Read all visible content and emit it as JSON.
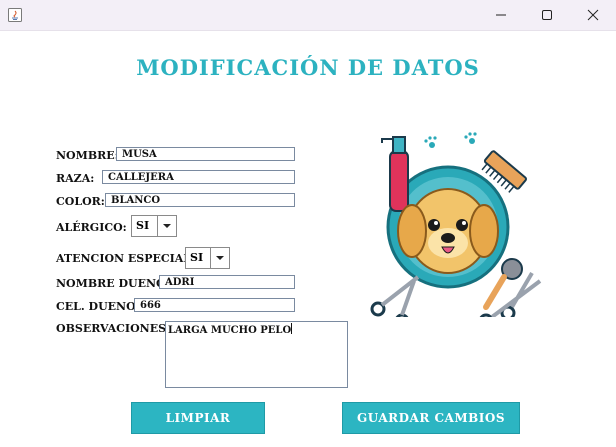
{
  "window": {
    "title": "",
    "minimize_icon": "minimize-icon",
    "maximize_icon": "maximize-icon",
    "close_icon": "close-icon"
  },
  "form": {
    "title": "MODIFICACIÓN DE DATOS",
    "fields": {
      "nombre": {
        "label": "NOMBRE:",
        "value": "MUSA"
      },
      "raza": {
        "label": "RAZA:",
        "value": "CALLEJERA"
      },
      "color": {
        "label": "COLOR:",
        "value": "BLANCO"
      },
      "alergico": {
        "label": "ALÉRGICO:",
        "value": "SI"
      },
      "atencion": {
        "label": "ATENCION ESPECIAL:",
        "value": "SI"
      },
      "dueno": {
        "label": "NOMBRE DUENO:",
        "value": "ADRI"
      },
      "celular": {
        "label": "CEL. DUENO:",
        "value": "666"
      },
      "observaciones": {
        "label": "OBSERVACIONES:",
        "value": "LARGA MUCHO PELO"
      }
    },
    "buttons": {
      "clear": "LIMPIAR",
      "save": "GUARDAR CAMBIOS"
    }
  },
  "colors": {
    "accent": "#2cb5c2",
    "title": "#2cb2c0"
  },
  "illustration": {
    "icon": "dog-grooming-illustration"
  }
}
